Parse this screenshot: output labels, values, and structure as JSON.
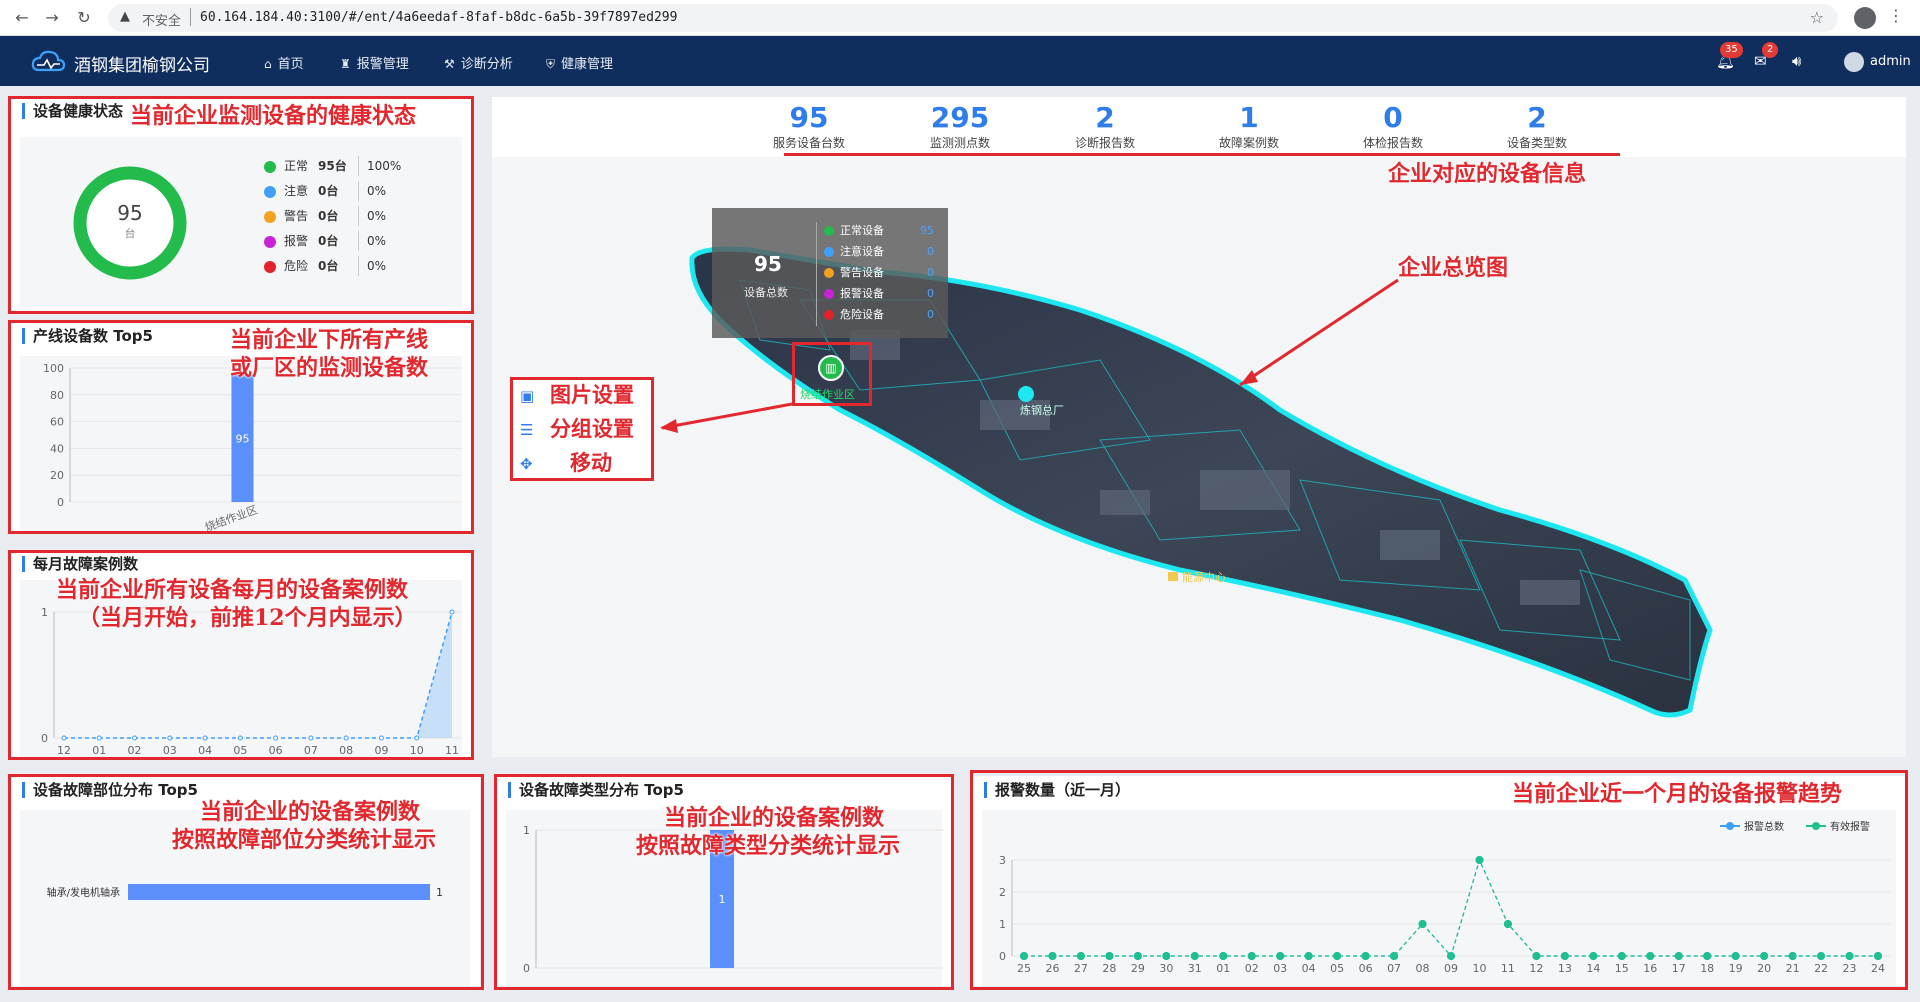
{
  "browser": {
    "insecure": "不安全",
    "url": "60.164.184.40:3100/#/ent/4a6eedaf-8faf-b8dc-6a5b-39f7897ed299"
  },
  "nav": {
    "brand": "酒钢集团榆钢公司",
    "menu": [
      {
        "label": "首页"
      },
      {
        "label": "报警管理"
      },
      {
        "label": "诊断分析"
      },
      {
        "label": "健康管理"
      }
    ],
    "badge_alarm": "35",
    "badge_msg": "2",
    "user": "admin"
  },
  "health": {
    "title": "设备健康状态",
    "total": "95",
    "unit": "台",
    "legend": [
      {
        "name": "正常",
        "count": "95台",
        "pct": "100%",
        "color": "#22bb4c"
      },
      {
        "name": "注意",
        "count": "0台",
        "pct": "0%",
        "color": "#3fa0f7"
      },
      {
        "name": "警告",
        "count": "0台",
        "pct": "0%",
        "color": "#f2a21f"
      },
      {
        "name": "报警",
        "count": "0台",
        "pct": "0%",
        "color": "#c823d6"
      },
      {
        "name": "危险",
        "count": "0台",
        "pct": "0%",
        "color": "#e2232b"
      }
    ]
  },
  "stats": [
    {
      "value": "95",
      "label": "服务设备台数"
    },
    {
      "value": "295",
      "label": "监测测点数"
    },
    {
      "value": "2",
      "label": "诊断报告数"
    },
    {
      "value": "1",
      "label": "故障案例数"
    },
    {
      "value": "0",
      "label": "体检报告数"
    },
    {
      "value": "2",
      "label": "设备类型数"
    }
  ],
  "map": {
    "tooltip": {
      "total": "95",
      "total_label": "设备总数",
      "rows": [
        {
          "name": "正常设备",
          "value": "95",
          "color": "#22bb4c"
        },
        {
          "name": "注意设备",
          "value": "0",
          "color": "#3fa0f7"
        },
        {
          "name": "警告设备",
          "value": "0",
          "color": "#f2a21f"
        },
        {
          "name": "报警设备",
          "value": "0",
          "color": "#c823d6"
        },
        {
          "name": "危险设备",
          "value": "0",
          "color": "#e2232b"
        }
      ]
    },
    "marker_label": "烧结作业区",
    "label_b": "炼钢总厂",
    "label_c": "能源中心",
    "tools": [
      {
        "label": "图片设置"
      },
      {
        "label": "分组设置"
      },
      {
        "label": "移动"
      }
    ]
  },
  "panels": {
    "top5": "产线设备数 Top5",
    "monthly": "每月故障案例数",
    "part": "设备故障部位分布 Top5",
    "type": "设备故障类型分布 Top5",
    "alarm": "报警数量（近一月）"
  },
  "annotations": {
    "a1": "当前企业监测设备的健康状态",
    "a2": "企业对应的设备信息",
    "a3": "企业总览图",
    "a4_1": "当前企业下所有产线",
    "a4_2": "或厂区的监测设备数",
    "a5_1": "当前企业所有设备每月的设备案例数",
    "a5_2": "（当月开始，前推12个月内显示）",
    "a6_1": "当前企业的设备案例数",
    "a6_2": "按照故障部位分类统计显示",
    "a7_1": "当前企业的设备案例数",
    "a7_2": "按照故障类型分类统计显示",
    "a8": "当前企业近一个月的设备报警趋势"
  },
  "chart_data": [
    {
      "id": "top5",
      "type": "bar",
      "categories": [
        "烧结作业区"
      ],
      "values": [
        95
      ],
      "ylim": [
        0,
        100
      ],
      "yticks": [
        0,
        20,
        40,
        60,
        80,
        100
      ],
      "color": "#5b8ff9"
    },
    {
      "id": "monthly",
      "type": "area",
      "x": [
        "12",
        "01",
        "02",
        "03",
        "04",
        "05",
        "06",
        "07",
        "08",
        "09",
        "10",
        "11"
      ],
      "values": [
        0,
        0,
        0,
        0,
        0,
        0,
        0,
        0,
        0,
        0,
        0,
        1
      ],
      "ylim": [
        0,
        1
      ],
      "yticks": [
        0,
        1
      ],
      "color": "#3fa0f7"
    },
    {
      "id": "part",
      "type": "bar",
      "orientation": "horizontal",
      "categories": [
        "轴承/发电机轴承"
      ],
      "values": [
        1
      ],
      "color": "#5b8ff9"
    },
    {
      "id": "type",
      "type": "bar",
      "categories": [
        ""
      ],
      "values": [
        1
      ],
      "ylim": [
        0,
        1
      ],
      "yticks": [
        0,
        1
      ],
      "color": "#5b8ff9"
    },
    {
      "id": "alarm",
      "type": "line",
      "x": [
        "25",
        "26",
        "27",
        "28",
        "29",
        "30",
        "31",
        "01",
        "02",
        "03",
        "04",
        "05",
        "06",
        "07",
        "08",
        "09",
        "10",
        "11",
        "12",
        "13",
        "14",
        "15",
        "16",
        "17",
        "18",
        "19",
        "20",
        "21",
        "22",
        "23",
        "24"
      ],
      "series": [
        {
          "name": "报警总数",
          "values": [
            0,
            0,
            0,
            0,
            0,
            0,
            0,
            0,
            0,
            0,
            0,
            0,
            0,
            0,
            1,
            0,
            3,
            1,
            0,
            0,
            0,
            0,
            0,
            0,
            0,
            0,
            0,
            0,
            0,
            0,
            0
          ],
          "color": "#3fa0f7"
        },
        {
          "name": "有效报警",
          "values": [
            0,
            0,
            0,
            0,
            0,
            0,
            0,
            0,
            0,
            0,
            0,
            0,
            0,
            0,
            1,
            0,
            3,
            1,
            0,
            0,
            0,
            0,
            0,
            0,
            0,
            0,
            0,
            0,
            0,
            0,
            0
          ],
          "color": "#1fbf8f"
        }
      ],
      "ylim": [
        0,
        3
      ],
      "yticks": [
        0,
        1,
        2,
        3
      ],
      "legend": "top-right"
    }
  ]
}
